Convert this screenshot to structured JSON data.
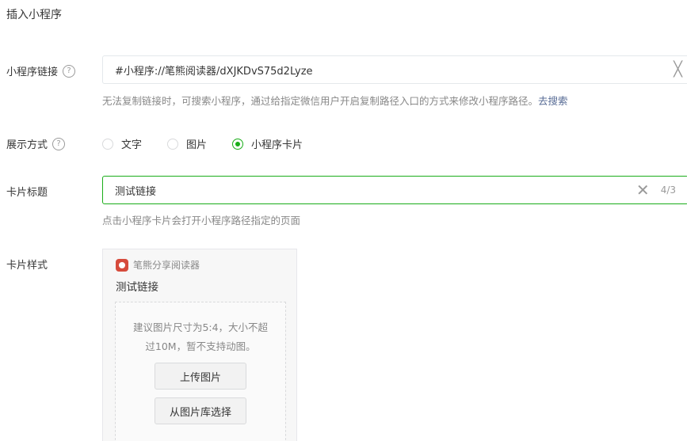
{
  "page": {
    "title": "插入小程序"
  },
  "link_field": {
    "label": "小程序链接",
    "help": "?",
    "value": "#小程序://笔熊阅读器/dXJKDvS75d2Lyze",
    "clear": "╳",
    "hint": "无法复制链接时，可搜索小程序，通过给指定微信用户开启复制路径入口的方式来修改小程序路径。",
    "hint_link": "去搜索"
  },
  "display_mode": {
    "label": "展示方式",
    "help": "?",
    "options": [
      {
        "label": "文字",
        "checked": false
      },
      {
        "label": "图片",
        "checked": false
      },
      {
        "label": "小程序卡片",
        "checked": true
      }
    ]
  },
  "card_title_field": {
    "label": "卡片标题",
    "value": "测试链接",
    "clear": "✕",
    "counter": "4/3",
    "hint": "点击小程序卡片会打开小程序路径指定的页面"
  },
  "card_style": {
    "label": "卡片样式",
    "brand_name": "笔熊分享阅读器",
    "card_title": "测试链接",
    "upload_tip_line1": "建议图片尺寸为5:4，大小不超",
    "upload_tip_line2": "过10M，暂不支持动图。",
    "upload_button": "上传图片",
    "library_button": "从图片库选择"
  },
  "colors": {
    "accent": "#1aad19",
    "link": "#576b95",
    "brand": "#d64b3c"
  }
}
